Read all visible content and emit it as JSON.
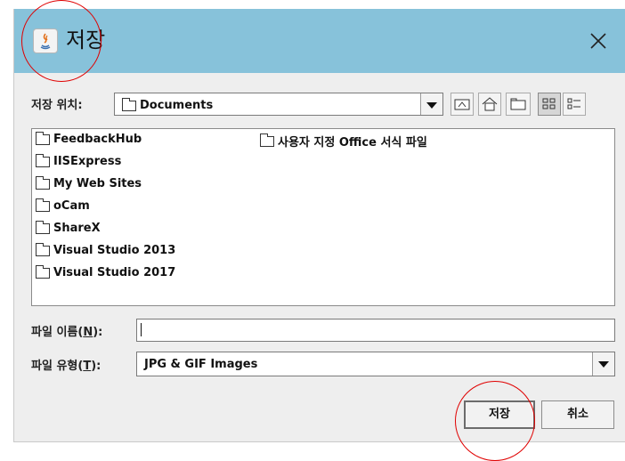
{
  "dialog": {
    "title": "저장",
    "close_symbol": "×",
    "icon": "java-icon"
  },
  "location": {
    "label": "저장 위치:",
    "value": "Documents",
    "toolbar_icons": [
      "up-folder-icon",
      "home-icon",
      "new-folder-icon",
      "list-view-icon",
      "details-view-icon"
    ]
  },
  "files": {
    "column1": [
      "FeedbackHub",
      "IISExpress",
      "My Web Sites",
      "oCam",
      "ShareX",
      "Visual Studio 2013",
      "Visual Studio 2017"
    ],
    "column2": [
      "사용자 지정 Office 서식 파일"
    ]
  },
  "filename": {
    "label_prefix": "파일 이름(",
    "mnemonic": "N",
    "label_suffix": "):",
    "value": ""
  },
  "filetype": {
    "label_prefix": "파일 유형(",
    "mnemonic": "T",
    "label_suffix": "):",
    "value": "JPG & GIF Images"
  },
  "buttons": {
    "save": "저장",
    "cancel": "취소"
  },
  "colors": {
    "titlebar": "#87c2da",
    "annotation": "#e00000"
  }
}
